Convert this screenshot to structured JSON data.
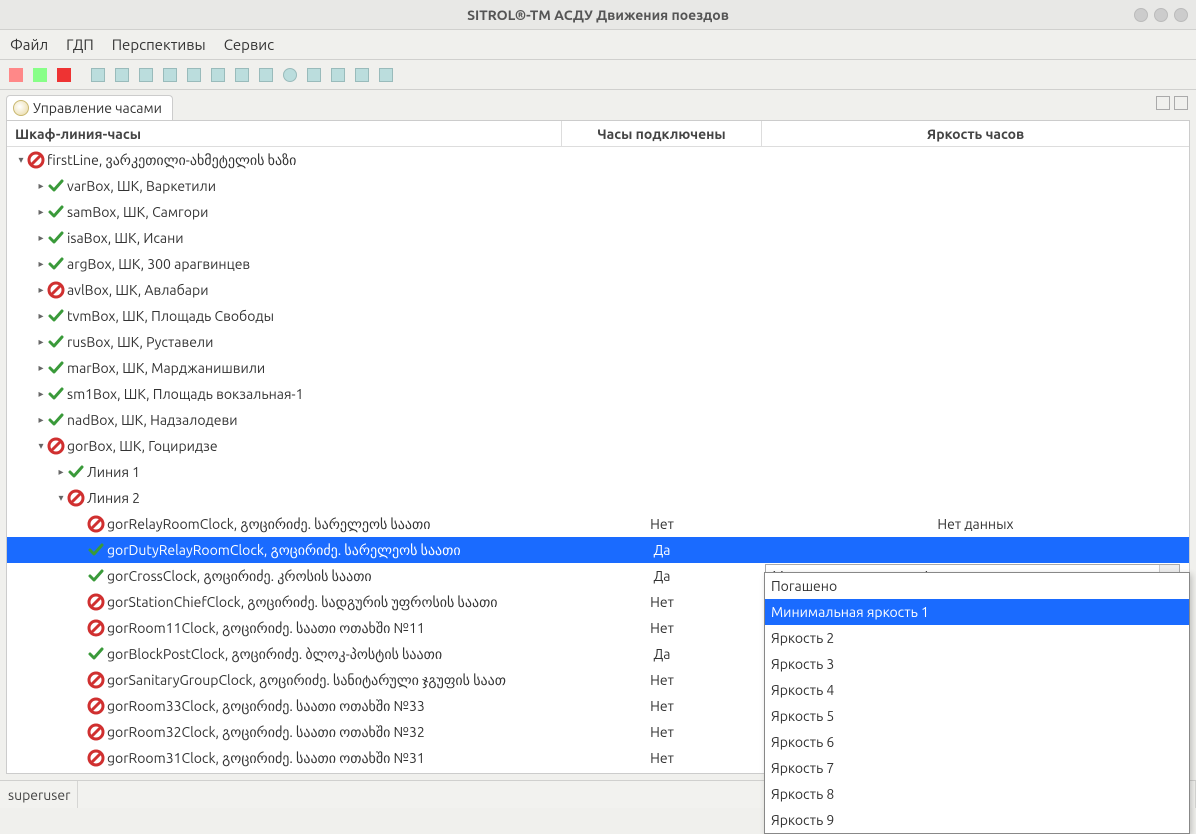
{
  "window": {
    "title": "SITROL®-TM АСДУ Движения поездов"
  },
  "menubar": [
    "Файл",
    "ГДП",
    "Перспективы",
    "Сервис"
  ],
  "tab": {
    "title": "Управление часами"
  },
  "columns": {
    "col1": "Шкаф-линия-часы",
    "col2": "Часы подключены",
    "col3": "Яркость часов"
  },
  "tree": [
    {
      "indent": 0,
      "twisty": "open",
      "status": "no",
      "label": "firstLine, ვარკეთილი-ახმეტელის ხაზი"
    },
    {
      "indent": 1,
      "twisty": "closed",
      "status": "ok",
      "label": "varBox, ШК, Варкетили"
    },
    {
      "indent": 1,
      "twisty": "closed",
      "status": "ok",
      "label": "samBox, ШК, Самгори"
    },
    {
      "indent": 1,
      "twisty": "closed",
      "status": "ok",
      "label": "isaBox, ШК, Исани"
    },
    {
      "indent": 1,
      "twisty": "closed",
      "status": "ok",
      "label": "argBox, ШК, 300 арагвинцев"
    },
    {
      "indent": 1,
      "twisty": "closed",
      "status": "no",
      "label": "avlBox, ШК, Авлабари"
    },
    {
      "indent": 1,
      "twisty": "closed",
      "status": "ok",
      "label": "tvmBox, ШК, Площадь Свободы"
    },
    {
      "indent": 1,
      "twisty": "closed",
      "status": "ok",
      "label": "rusBox, ШК, Руставели"
    },
    {
      "indent": 1,
      "twisty": "closed",
      "status": "ok",
      "label": "marBox, ШК, Марджанишвили"
    },
    {
      "indent": 1,
      "twisty": "closed",
      "status": "ok",
      "label": "sm1Box, ШК, Площадь вокзальная-1"
    },
    {
      "indent": 1,
      "twisty": "closed",
      "status": "ok",
      "label": "nadBox, ШК, Надзалодеви"
    },
    {
      "indent": 1,
      "twisty": "open",
      "status": "no",
      "label": "gorBox, ШК, Гоциридзе"
    },
    {
      "indent": 2,
      "twisty": "closed",
      "status": "ok",
      "label": "Линия 1"
    },
    {
      "indent": 2,
      "twisty": "open",
      "status": "no",
      "label": "Линия 2"
    },
    {
      "indent": 3,
      "twisty": "none",
      "status": "no",
      "label": "gorRelayRoomClock, გოცირიძე. სარელეოს საათი",
      "c2": "Нет",
      "c3": "Нет данных"
    },
    {
      "indent": 3,
      "twisty": "none",
      "status": "ok",
      "label": "gorDutyRelayRoomClock, გოცირიძე. სარელეოს საათი",
      "c2": "Да",
      "c3": "Минимальная яркость 1",
      "selected": true,
      "combo": true
    },
    {
      "indent": 3,
      "twisty": "none",
      "status": "ok",
      "label": "gorCrossClock, გოცირიძე. კროსის საათი",
      "c2": "Да"
    },
    {
      "indent": 3,
      "twisty": "none",
      "status": "no",
      "label": "gorStationChiefClock, გოცირიძე. სადგურის უფროსის საათი",
      "c2": "Нет"
    },
    {
      "indent": 3,
      "twisty": "none",
      "status": "no",
      "label": "gorRoom11Clock, გოცირიძე. საათი ოთახში №11",
      "c2": "Нет"
    },
    {
      "indent": 3,
      "twisty": "none",
      "status": "ok",
      "label": "gorBlockPostClock, გოცირიძე. ბლოკ-პოსტის საათი",
      "c2": "Да"
    },
    {
      "indent": 3,
      "twisty": "none",
      "status": "no",
      "label": "gorSanitaryGroupClock, გოცირიძე. სანიტარული ჯგუფის საათ",
      "c2": "Нет"
    },
    {
      "indent": 3,
      "twisty": "none",
      "status": "no",
      "label": "gorRoom33Clock, გოცირიძე. საათი ოთახში №33",
      "c2": "Нет"
    },
    {
      "indent": 3,
      "twisty": "none",
      "status": "no",
      "label": "gorRoom32Clock, გოცირიძე. საათი ოთახში №32",
      "c2": "Нет"
    },
    {
      "indent": 3,
      "twisty": "none",
      "status": "no",
      "label": "gorRoom31Clock, გოცირიძე. საათი ოთახში №31",
      "c2": "Нет"
    }
  ],
  "dropdown": {
    "items": [
      "Погашено",
      "Минимальная яркость 1",
      "Яркость 2",
      "Яркость 3",
      "Яркость 4",
      "Яркость 5",
      "Яркость 6",
      "Яркость 7",
      "Яркость 8",
      "Яркость 9"
    ],
    "selected_index": 1
  },
  "statusbar": {
    "user": "superuser"
  }
}
